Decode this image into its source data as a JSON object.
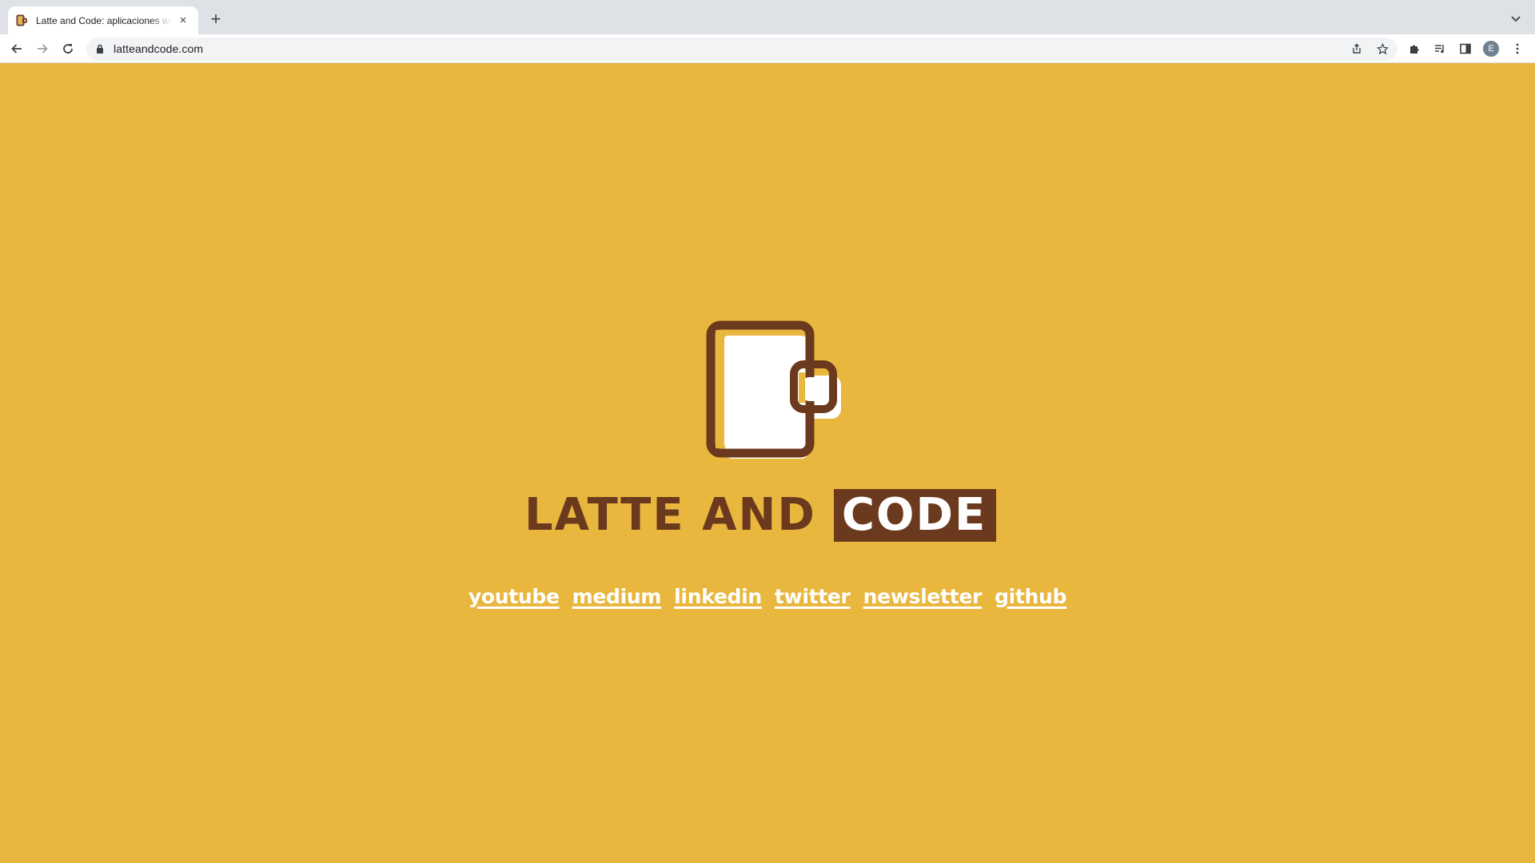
{
  "browser": {
    "tab": {
      "title": "Latte and Code: aplicaciones web",
      "close_glyph": "×",
      "favicon": "latte-and-code-favicon"
    },
    "new_tab_glyph": "+",
    "address": {
      "url": "latteandcode.com"
    },
    "profile_initial": "E",
    "icons": [
      "back-icon",
      "forward-icon",
      "reload-icon",
      "lock-icon",
      "share-icon",
      "star-icon",
      "extensions-icon",
      "media-icon",
      "side-panel-icon",
      "menu-icon",
      "tab-search-icon"
    ]
  },
  "page": {
    "background": "#e9b73e",
    "brand_color": "#6b3a1e",
    "logo": {
      "word_plain": "LATTE AND",
      "word_boxed": "CODE"
    },
    "links": [
      {
        "label": "youtube"
      },
      {
        "label": "medium"
      },
      {
        "label": "linkedin"
      },
      {
        "label": "twitter"
      },
      {
        "label": "newsletter"
      },
      {
        "label": "github"
      }
    ]
  }
}
